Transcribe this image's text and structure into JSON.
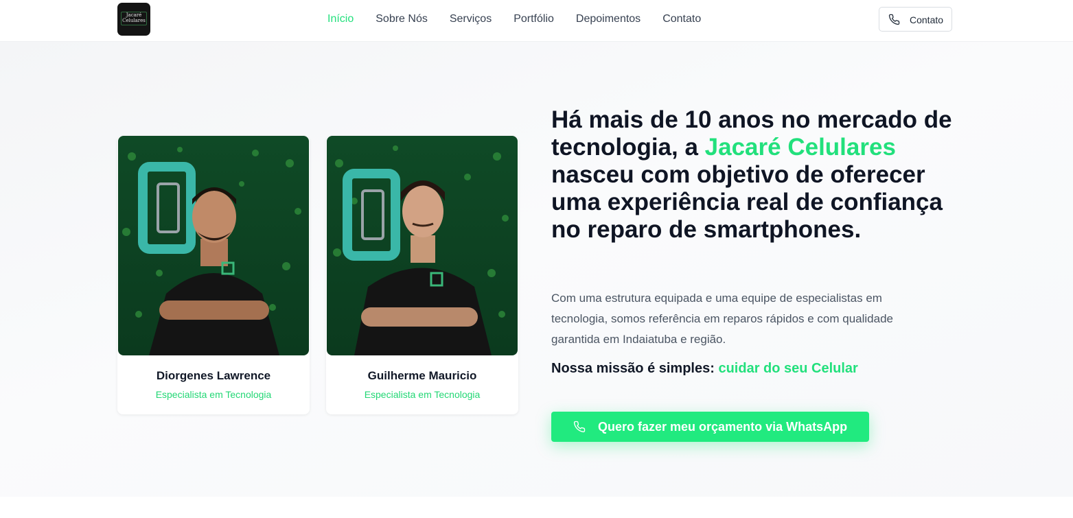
{
  "header": {
    "logo_text": "Jacaré Celulares",
    "nav": [
      {
        "label": "Início",
        "active": true
      },
      {
        "label": "Sobre Nós"
      },
      {
        "label": "Serviços"
      },
      {
        "label": "Portfólio"
      },
      {
        "label": "Depoimentos"
      },
      {
        "label": "Contato"
      }
    ],
    "contact_button": {
      "label": "Contato",
      "icon": "phone-icon"
    }
  },
  "hero": {
    "team": [
      {
        "name": "Diorgenes Lawrence",
        "role": "Especialista em Tecnologia"
      },
      {
        "name": "Guilherme Mauricio",
        "role": "Especialista em Tecnologia"
      }
    ],
    "headline_before": "Há mais de 10 anos no mercado de tecnologia, a ",
    "headline_brand": "Jacaré Celulares",
    "headline_after": " nasceu com objetivo de oferecer uma experiência real de confiança no reparo de smartphones.",
    "paragraph": "Com uma estrutura equipada e uma equipe de especialistas em tecnologia, somos referência em reparos rápidos e com qualidade garantida em Indaiatuba e região.",
    "mission_label": "Nossa missão é simples: ",
    "mission_accent": "cuidar do seu Celular",
    "cta": {
      "label": "Quero fazer meu orçamento via WhatsApp",
      "icon": "phone-icon"
    }
  },
  "colors": {
    "accent": "#22e07c",
    "cta_background": "#21ea7f",
    "heading": "#0f1524",
    "body_text": "#4b5563"
  }
}
